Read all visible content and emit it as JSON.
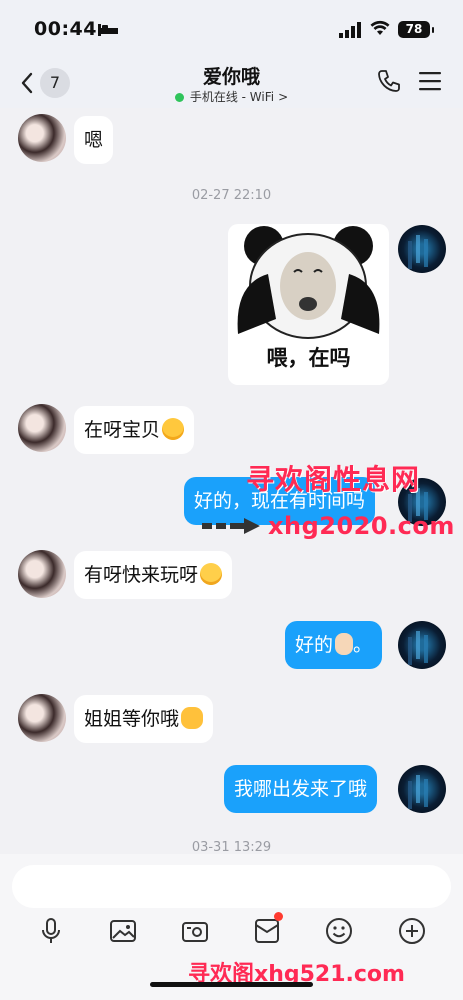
{
  "status_bar": {
    "time": "00:44",
    "battery": "78"
  },
  "header": {
    "unread_count": "7",
    "title": "爱你哦",
    "presence": "手机在线 - WiFi",
    "presence_chevron": ">"
  },
  "messages": [
    {
      "side": "left",
      "text": "嗯"
    },
    {
      "timestamp": "02-27 22:10"
    },
    {
      "side": "right",
      "sticker_caption": "喂，在吗"
    },
    {
      "side": "left",
      "text": "在呀宝贝",
      "emoji": "smiling-face-emoji"
    },
    {
      "side": "right",
      "text": "好的，现在有时间吗"
    },
    {
      "side": "left",
      "text": "有呀快来玩呀",
      "emoji": "pensive-face-emoji"
    },
    {
      "side": "right",
      "text": "好的",
      "text_after": "。",
      "emoji": "ok-hand-emoji"
    },
    {
      "side": "left",
      "text": "姐姐等你哦",
      "emoji": "hugging-face-emoji"
    },
    {
      "side": "right",
      "text": "我哪出发来了哦"
    },
    {
      "timestamp": "03-31 13:29"
    }
  ],
  "watermarks": {
    "line1": "寻欢阁性息网",
    "line2": "xhg2020.com",
    "line3": "寻欢阁xhg521.com"
  },
  "toolbar": {
    "input_placeholder": "",
    "tools": [
      "microphone-icon",
      "image-icon",
      "camera-icon",
      "red-packet-icon",
      "emoji-icon",
      "add-icon"
    ],
    "badge_color": "#ff3b30"
  },
  "colors": {
    "accent": "#1aa1fb",
    "online_dot": "#2fc45b",
    "watermark": "#ff2a54"
  }
}
